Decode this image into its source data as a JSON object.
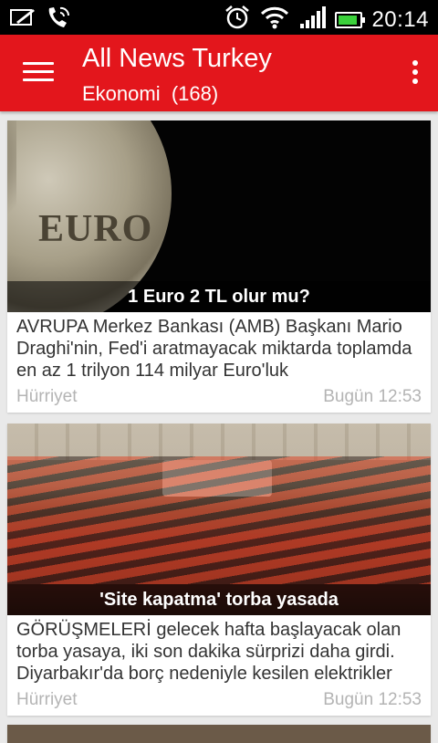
{
  "status_bar": {
    "time": "20:14",
    "icons": [
      "edit-icon",
      "phone-call-icon",
      "alarm-icon",
      "wifi-icon",
      "signal-icon",
      "battery-icon"
    ],
    "battery_level": 0.9,
    "battery_color": "#3bd13b"
  },
  "action_bar": {
    "title": "All News Turkey",
    "subtitle": "Ekonomi  (168)",
    "color": "#e3161c",
    "menu_icon": "hamburger-menu-icon",
    "overflow_icon": "overflow-menu-icon"
  },
  "news": [
    {
      "caption": "1 Euro 2 TL olur mu?",
      "summary": "AVRUPA Merkez Bankası (AMB) Başkanı Mario Draghi'nin, Fed'i aratmayacak miktarda toplamda en az 1 trilyon 114 milyar Euro'luk",
      "source": "Hürriyet",
      "time": "Bugün 12:53",
      "image_text": "EURO"
    },
    {
      "caption": "'Site kapatma' torba yasada",
      "summary": "GÖRÜŞMELERİ gelecek hafta başlayacak olan torba yasaya, iki son dakika sürprizi daha girdi. Diyarbakır'da borç nedeniyle kesilen elektrikler",
      "source": "Hürriyet",
      "time": "Bugün 12:53"
    }
  ]
}
